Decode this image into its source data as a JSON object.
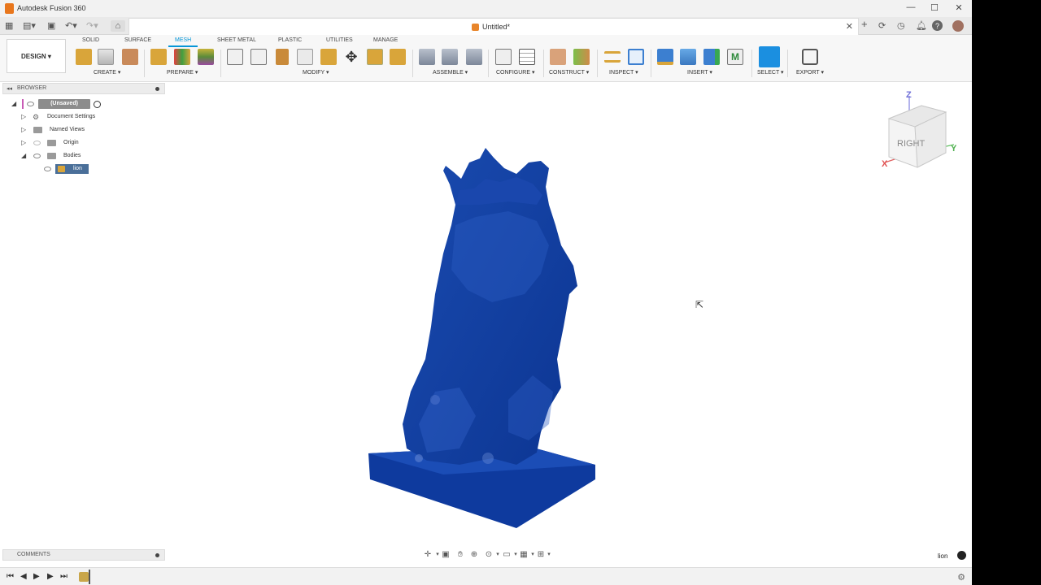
{
  "window": {
    "app_title": "Autodesk Fusion 360",
    "minimize": "—",
    "maximize": "☐",
    "close": "✕"
  },
  "document": {
    "title": "Untitled*",
    "close": "✕"
  },
  "workspace": {
    "switcher": "DESIGN ▾",
    "tabs": [
      "SOLID",
      "SURFACE",
      "MESH",
      "SHEET METAL",
      "PLASTIC",
      "UTILITIES",
      "MANAGE"
    ],
    "active_tab": "MESH"
  },
  "toolbar": {
    "groups": [
      "CREATE ▾",
      "PREPARE ▾",
      "MODIFY ▾",
      "ASSEMBLE ▾",
      "CONFIGURE ▾",
      "CONSTRUCT ▾",
      "INSPECT ▾",
      "INSERT ▾",
      "SELECT ▾",
      "EXPORT ▾"
    ]
  },
  "browser": {
    "title": "BROWSER",
    "collapse_icon": "◂◂",
    "root": "(Unsaved)",
    "items": [
      {
        "label": "Document Settings"
      },
      {
        "label": "Named Views"
      },
      {
        "label": "Origin"
      },
      {
        "label": "Bodies"
      }
    ],
    "selected_body": "lion"
  },
  "viewcube": {
    "face": "RIGHT",
    "axis_z": "Z",
    "axis_x": "X",
    "axis_y": "Y"
  },
  "comments": {
    "title": "COMMENTS"
  },
  "status": {
    "selected_body": "lion"
  },
  "timeline": {
    "first": "⏮",
    "prev": "◀",
    "play": "▶",
    "next": "▶",
    "last": "⏭",
    "settings_icon": "⚙"
  },
  "colors": {
    "accent": "#0696d7",
    "mesh": "#0f3fa0",
    "app_icon": "#e8761c"
  }
}
